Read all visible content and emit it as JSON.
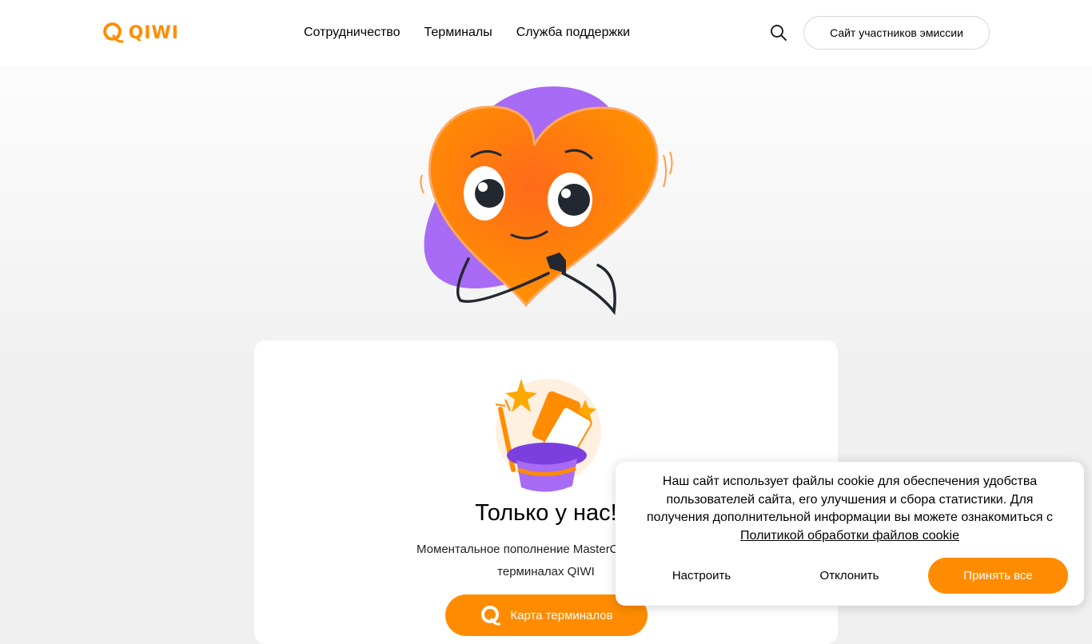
{
  "header": {
    "logo_text": "QIWI",
    "nav": [
      {
        "label": "Сотрудничество"
      },
      {
        "label": "Терминалы"
      },
      {
        "label": "Служба поддержки"
      }
    ],
    "search_icon": "search-icon",
    "emission_button": "Сайт участников эмиссии"
  },
  "hero": {
    "illustration": "heart-mascot"
  },
  "card": {
    "illustration": "magic-hat-card",
    "title": "Только у нас!",
    "description_line1": "Моментальное пополнение MasterCard, Visa и",
    "description_line2": "терминалах QIWI",
    "map_button": "Карта терминалов"
  },
  "cookie_banner": {
    "text": "Наш сайт использует файлы cookie для обеспечения удобства пользователей сайта, его улучшения и сбора статистики. Для получения дополнительной информации вы можете ознакомиться с",
    "link": "Политикой обработки файлов cookie",
    "configure_button": "Настроить",
    "decline_button": "Отклонить",
    "accept_button": "Принять все"
  },
  "colors": {
    "accent": "#ff8c00",
    "purple": "#a86bf5",
    "background": "#f0f0f0"
  }
}
